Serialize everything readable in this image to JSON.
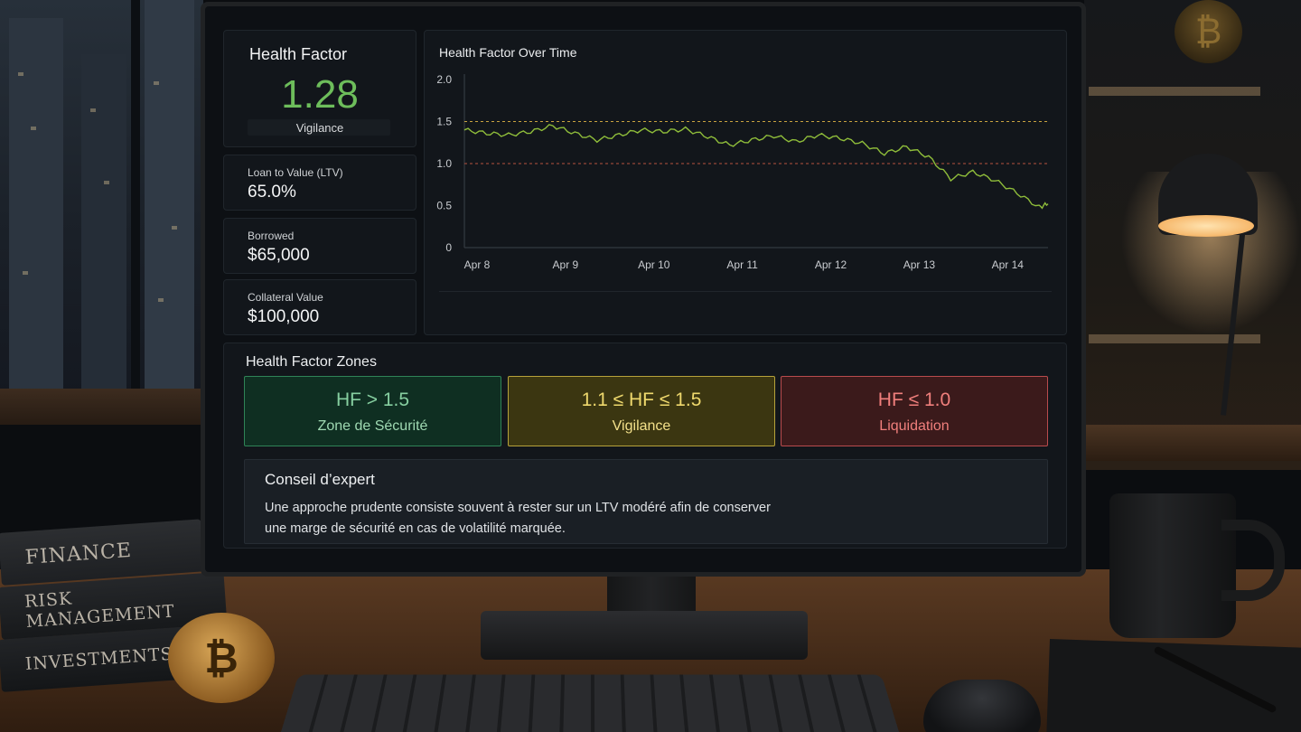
{
  "health_factor": {
    "title": "Health Factor",
    "value": "1.28",
    "status": "Vigilance",
    "value_color": "#6dbd5b"
  },
  "stats": [
    {
      "label": "Loan to Value (LTV)",
      "value": "65.0%"
    },
    {
      "label": "Borrowed",
      "value": "$65,000"
    },
    {
      "label": "Collateral Value",
      "value": "$100,000"
    }
  ],
  "chart_data": {
    "type": "line",
    "title": "Health Factor Over Time",
    "x_ticks": [
      "Apr 8",
      "Apr 9",
      "Apr 10",
      "Apr 11",
      "Apr 12",
      "Apr 13",
      "Apr 14"
    ],
    "y_ticks": [
      "0",
      "0.5",
      "1.0",
      "1.5",
      "2.0"
    ],
    "ylim": [
      0,
      2.0
    ],
    "xlim": [
      0,
      6.6
    ],
    "reference_lines": [
      {
        "value": 1.5,
        "color": "#c9a340"
      },
      {
        "value": 1.0,
        "color": "#b5513f"
      }
    ],
    "series": [
      {
        "color": "#8fbd3a",
        "x": [
          0,
          0.25,
          0.5,
          0.75,
          1.0,
          1.25,
          1.5,
          1.75,
          2.0,
          2.25,
          2.5,
          2.75,
          3.0,
          3.25,
          3.5,
          3.75,
          4.0,
          4.25,
          4.5,
          4.75,
          5.0,
          5.25,
          5.5,
          5.75,
          6.0,
          6.25,
          6.5,
          6.6
        ],
        "y": [
          1.4,
          1.36,
          1.34,
          1.38,
          1.45,
          1.36,
          1.28,
          1.34,
          1.4,
          1.38,
          1.41,
          1.32,
          1.22,
          1.28,
          1.33,
          1.26,
          1.34,
          1.3,
          1.24,
          1.12,
          1.2,
          1.08,
          0.82,
          0.9,
          0.8,
          0.65,
          0.48,
          0.52
        ]
      }
    ],
    "grid": false
  },
  "zones": {
    "title": "Health Factor Zones",
    "items": [
      {
        "condition": "HF > 1.5",
        "label": "Zone de Sécurité",
        "color": "#2f8457"
      },
      {
        "condition": "1.1 ≤ HF ≤ 1.5",
        "label": "Vigilance",
        "color": "#b6a23a"
      },
      {
        "condition": "HF  ≤ 1.0",
        "label": "Liquidation",
        "color": "#b94b4d"
      }
    ]
  },
  "advice": {
    "title": "Conseil d’expert",
    "text_line1": "Une approche prudente consiste souvent à rester sur un LTV modéré afin de conserver",
    "text_line2": "une marge de sécurité en cas de volatilité marquée."
  },
  "scene": {
    "books": [
      "FINANCE",
      "RISK MANAGEMENT",
      "INVESTMENTS"
    ],
    "coin_icon": "bitcoin-icon"
  }
}
